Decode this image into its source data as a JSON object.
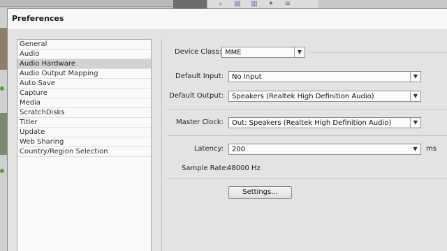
{
  "dialog": {
    "title": "Preferences"
  },
  "categories": [
    {
      "label": "General"
    },
    {
      "label": "Audio"
    },
    {
      "label": "Audio Hardware",
      "selected": true
    },
    {
      "label": "Audio Output Mapping"
    },
    {
      "label": "Auto Save"
    },
    {
      "label": "Capture"
    },
    {
      "label": "Media"
    },
    {
      "label": "ScratchDisks"
    },
    {
      "label": "Titler"
    },
    {
      "label": "Update"
    },
    {
      "label": "Web Sharing"
    },
    {
      "label": "Country/Region Selection"
    }
  ],
  "audio_hardware": {
    "device_class_label": "Device Class:",
    "device_class_value": "MME",
    "default_input_label": "Default Input:",
    "default_input_value": "No Input",
    "default_output_label": "Default Output:",
    "default_output_value": "Speakers (Realtek High Definition Audio)",
    "master_clock_label": "Master Clock:",
    "master_clock_value": "Out: Speakers (Realtek High Definition Audio)",
    "latency_label": "Latency:",
    "latency_value": "200",
    "latency_unit": "ms",
    "sample_rate_label": "Sample Rate:",
    "sample_rate_value": "48000 Hz",
    "settings_button": "Settings..."
  },
  "icons": {
    "toolbar": [
      "search-icon",
      "new-item-icon",
      "delete-icon",
      "pin-icon",
      "menu-icon"
    ],
    "dropdown": "chevron-down-icon"
  },
  "colors": {
    "selection": "#d2d2d2",
    "dialog_bg": "#e3e3e3",
    "titlebar_bg": "#f7f7f7"
  }
}
